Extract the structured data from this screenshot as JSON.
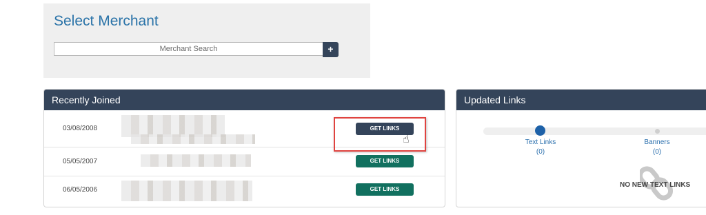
{
  "merchant_panel": {
    "title": "Select Merchant",
    "search_placeholder": "Merchant Search",
    "add_button": "+"
  },
  "recently_joined": {
    "title": "Recently Joined",
    "rows": [
      {
        "date": "03/08/2008",
        "button": "GET LINKS",
        "button_style": "dark"
      },
      {
        "date": "05/05/2007",
        "button": "GET LINKS",
        "button_style": "green"
      },
      {
        "date": "06/05/2006",
        "button": "GET LINKS",
        "button_style": "green"
      }
    ]
  },
  "updated_links": {
    "title": "Updated Links",
    "tabs": [
      {
        "label": "Text Links",
        "count": "(0)",
        "active": true
      },
      {
        "label": "Banners",
        "count": "(0)",
        "active": false
      }
    ],
    "empty_message": "NO NEW TEXT LINKS",
    "empty_icon": "chain-link-icon"
  },
  "colors": {
    "header_bg": "#34445a",
    "title_blue": "#2a73a8",
    "green_button": "#11705f",
    "highlight_red": "#e0433f"
  }
}
